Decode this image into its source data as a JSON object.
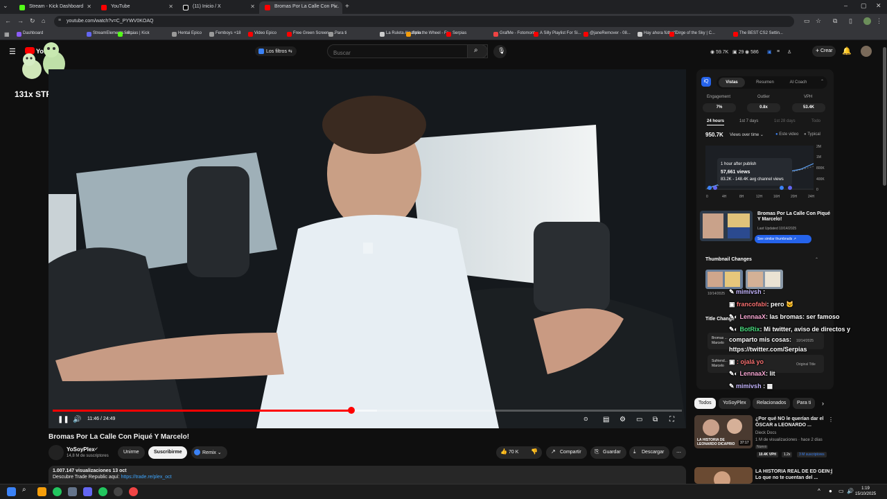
{
  "browser": {
    "tabs": [
      {
        "title": "Stream - Kick Dashboard",
        "color": "#53fc18"
      },
      {
        "title": "YouTube",
        "color": "#ff0000"
      },
      {
        "title": "(11) Inicio / X",
        "color": "#ffffff"
      },
      {
        "title": "Bromas Por La Calle Con Pi...",
        "color": "#ff0000"
      }
    ],
    "url": "youtube.com/watch?v=C_PYWV0KOAQ",
    "bookmarks": [
      {
        "label": "Dashboard",
        "color": "#8b5cf6"
      },
      {
        "label": "StreamElements - S...",
        "color": "#6366f1"
      },
      {
        "label": "Serpias | Kick",
        "color": "#53fc18"
      },
      {
        "label": "Hentai Epico",
        "color": "#999999"
      },
      {
        "label": "Femboys +18",
        "color": "#999999"
      },
      {
        "label": "Video Epico",
        "color": "#ff0000"
      },
      {
        "label": "Free Green Screen -...",
        "color": "#ff0000"
      },
      {
        "label": "Para ti",
        "color": "#999999"
      },
      {
        "label": "La Ruleta Aleatoria",
        "color": "#cccccc"
      },
      {
        "label": "Spin the Wheel - Fr...",
        "color": "#f59e0b"
      },
      {
        "label": "Serpias",
        "color": "#ff0000"
      },
      {
        "label": "GrafMe - Fotomont...",
        "color": "#ef4444"
      },
      {
        "label": "A Silly Playlist For Si...",
        "color": "#ff0000"
      },
      {
        "label": "@janeRemover - 08...",
        "color": "#ff0000"
      },
      {
        "label": "Hay ahora fútbol?",
        "color": "#cccccc"
      },
      {
        "label": "Dirge of the Sky | C...",
        "color": "#ff0000"
      },
      {
        "label": "The BEST CS2 Settin...",
        "color": "#ff0000"
      }
    ]
  },
  "youtube": {
    "logo": "You",
    "filters_label": "Los filtros",
    "search_placeholder": "Buscar",
    "stats": {
      "views": "59.7K",
      "comments": "29",
      "likes": "586"
    },
    "create_label": "Crear"
  },
  "overlay": {
    "streak": "131x STREAK"
  },
  "player": {
    "time": "11:46 / 24:49",
    "progress": 0.4743,
    "buffered": 0.515
  },
  "video": {
    "title": "Bromas Por La Calle Con Piqué Y Marcelo!",
    "channel": "YoSoyPlex",
    "subscribers": "14,8 M de suscriptores",
    "join_label": "Unirme",
    "subscribe_label": "Suscribirme",
    "remix_label": "Remix",
    "likes": "70 K",
    "share_label": "Compartir",
    "save_label": "Guardar",
    "download_label": "Descargar",
    "desc_stats": "1.007.147 visualizaciones  13 oct",
    "desc_line": "Descubre Trade Republic aquí: ",
    "desc_link": "https://trade.re/plex_oct"
  },
  "analytics": {
    "tabs": [
      "Vistas",
      "Resumen",
      "AI Coach"
    ],
    "metric_labels": [
      "Engagement",
      "Outlier",
      "VPH"
    ],
    "metric_values": [
      "7%",
      "0.8x",
      "53.4K"
    ],
    "ranges": [
      "24 hours",
      "1st 7 days",
      "1st 28 days",
      "Todo"
    ],
    "total_views": "950.7K",
    "views_mode": "Views over time",
    "legend": [
      "Este video",
      "Typical"
    ],
    "y_ticks": [
      "2M",
      "1M",
      "800K",
      "400K",
      "0"
    ],
    "x_ticks": [
      "0",
      "4H",
      "8H",
      "12H",
      "16H",
      "20H",
      "24H"
    ],
    "tooltip": {
      "line1": "1 hour after publish",
      "line2": "57,661 views",
      "line3": "83.2K - 148.4K avg channel views"
    },
    "card_title": "Bromas Por La Calle Con Piqué Y Marcelo!",
    "card_updated": "Last Updated 10/14/2025",
    "similar_button": "See similar thumbnails",
    "thumb_changes_label": "Thumbnail Changes",
    "thumb_change_date": "10/14/2025",
    "title_changes_label": "Title Change",
    "title_entries": [
      {
        "text": "Bromas ... Marcelo",
        "date": "10/14/2025"
      },
      {
        "text": "Sufriend... Marcelo",
        "date": "Original Title"
      }
    ]
  },
  "chat": [
    {
      "user": "mimivsh",
      "text": "",
      "color": "#c4b5fd"
    },
    {
      "user": "francofabi",
      "text": ": pero",
      "color": "#f87171"
    },
    {
      "user": "LennaaX",
      "text": ": las bromas: ser famoso",
      "color": "#f9a8d4"
    },
    {
      "user": "BotRix",
      "text": ": Mi twitter, aviso de directos y",
      "color": "#4ade80"
    },
    {
      "user": "",
      "text": "comparto mis cosas:",
      "color": "#ffffff"
    },
    {
      "user": "",
      "text": "https://twitter.com/Serpias",
      "color": "#ffffff"
    },
    {
      "user": "",
      "text": ": ojalá yo",
      "color": "#f87171"
    },
    {
      "user": "LennaaX",
      "text": ": lit",
      "color": "#f9a8d4"
    },
    {
      "user": "mimivsh",
      "text": ":",
      "color": "#c4b5fd"
    }
  ],
  "chips": [
    "Todos",
    "YoSoyPlex",
    "Relacionados",
    "Para ti"
  ],
  "recommended": [
    {
      "title": "¿Por qué NO le querían dar el ÓSCAR a LEONARDO ...",
      "channel": "Dieck Docs",
      "meta": "1 M de visualizaciones · hace 2 días",
      "badge": "Nuevo",
      "duration": "37:17",
      "thumb_text": "LA HISTORIA DE LEONARDO DICAPRIO",
      "vph": "10.4K VPH",
      "mult": "1.2x",
      "subs": "3 M suscriptores"
    },
    {
      "title": "LA HISTORIA REAL DE ED GEIN | Lo que no te cuentan del ...",
      "channel": "",
      "meta": "",
      "badge": "",
      "duration": "",
      "thumb_text": "",
      "vph": "",
      "mult": "",
      "subs": ""
    }
  ],
  "taskbar": {
    "time": "1:19",
    "date": "15/10/2025"
  }
}
